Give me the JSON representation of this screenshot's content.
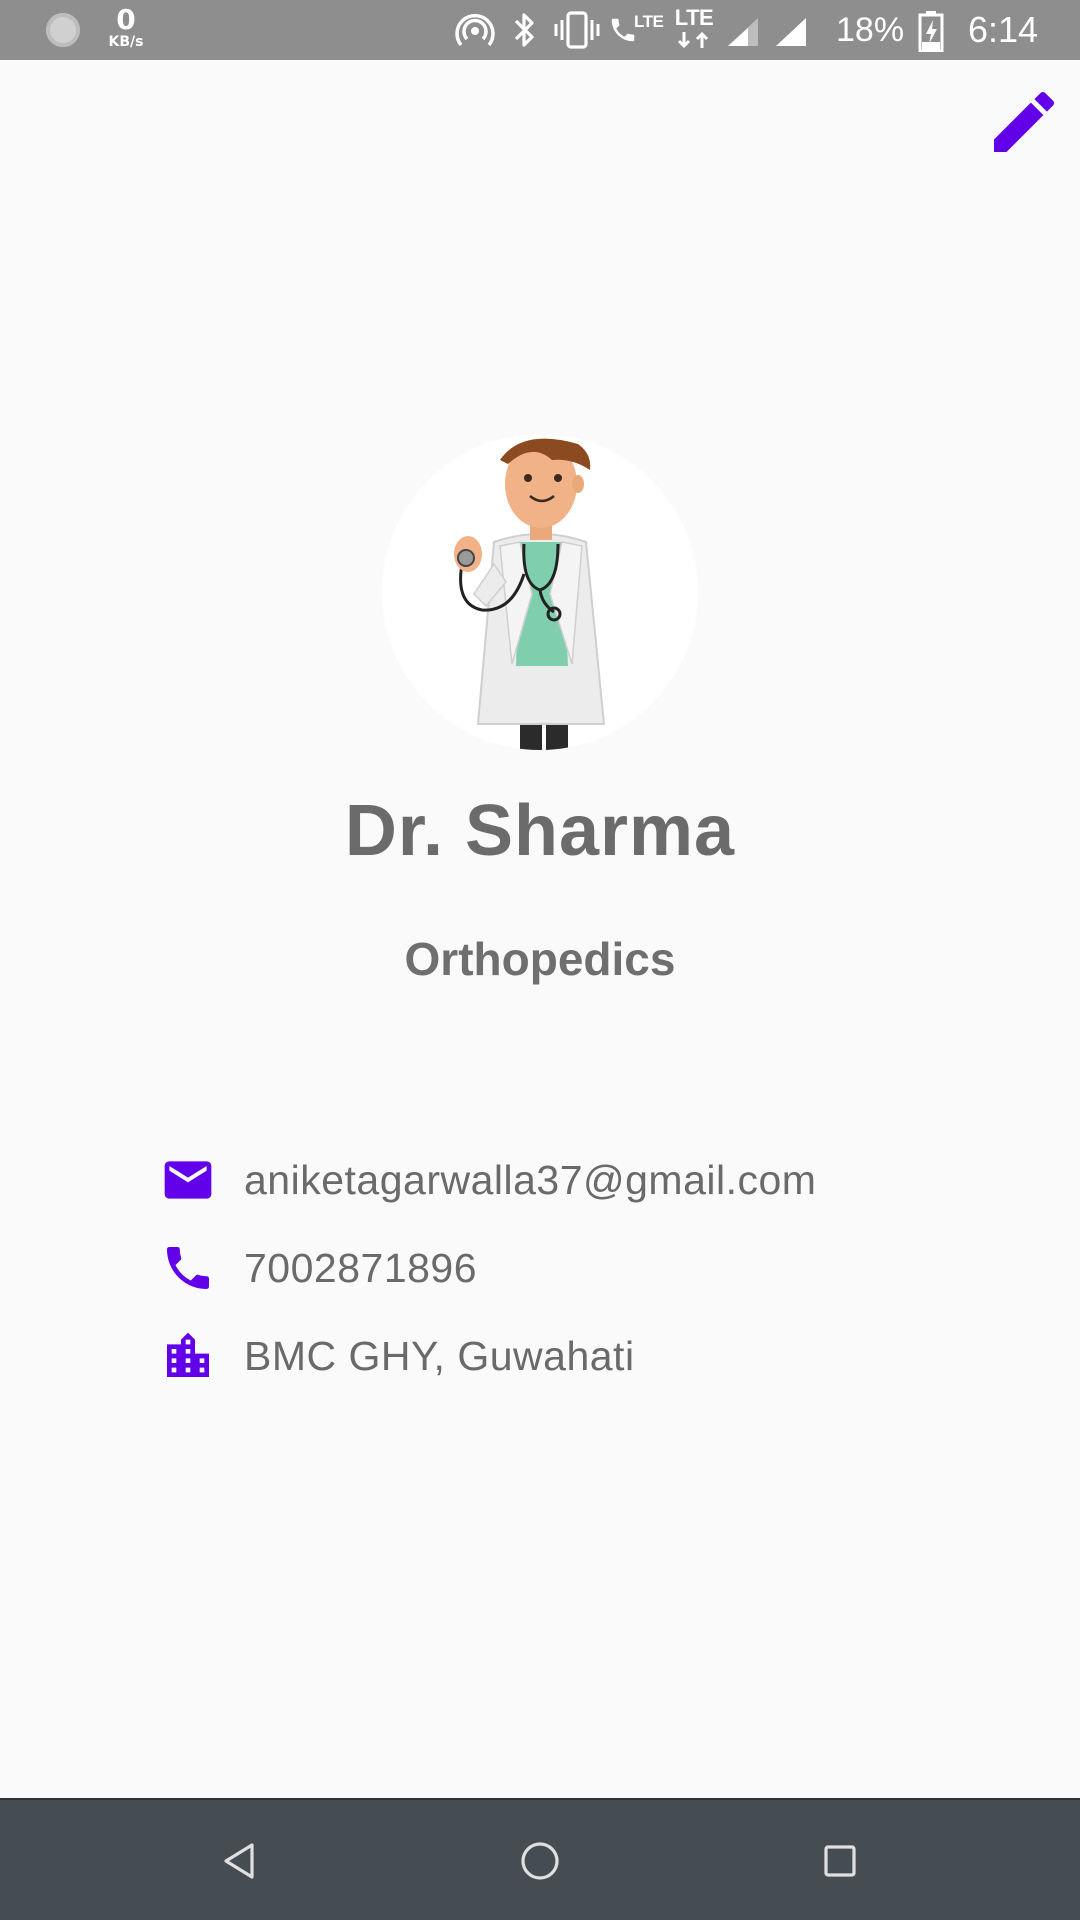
{
  "status_bar": {
    "net_speed_value": "0",
    "net_speed_unit": "KB/s",
    "lte_label_1": "LTE",
    "lte_label_2": "LTE",
    "battery_percent": "18%",
    "time": "6:14"
  },
  "profile": {
    "name": "Dr. Sharma",
    "department": "Orthopedics",
    "email": "aniketagarwalla37@gmail.com",
    "phone": "7002871896",
    "location": "BMC GHY, Guwahati"
  },
  "colors": {
    "accent": "#6200ea",
    "status_bar_bg": "#8e8e8e",
    "nav_bar_bg": "#464d52",
    "text_gray": "#6b6b6b"
  },
  "icons": {
    "edit": "pencil-icon",
    "email": "email-icon",
    "phone": "phone-icon",
    "location": "building-icon",
    "back": "back-triangle-icon",
    "home": "home-circle-icon",
    "recents": "recents-square-icon"
  }
}
